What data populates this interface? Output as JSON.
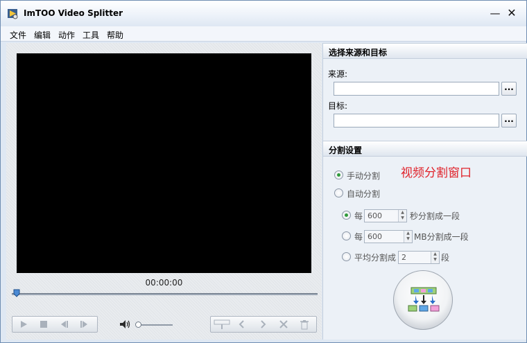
{
  "window": {
    "title": "ImTOO Video Splitter",
    "minimize": "—",
    "close": "✕"
  },
  "menu": [
    "文件",
    "编辑",
    "动作",
    "工具",
    "帮助"
  ],
  "player": {
    "time": "00:00:00",
    "seek_fraction": 0.0
  },
  "source_target": {
    "header": "选择来源和目标",
    "source_label": "来源:",
    "source_value": "",
    "target_label": "目标:",
    "target_value": "",
    "browse": "..."
  },
  "split_settings": {
    "header": "分割设置",
    "manual": "手动分割",
    "auto": "自动分割",
    "every_sec": {
      "prefix": "每",
      "value": "600",
      "suffix": "秒分割成一段"
    },
    "every_mb": {
      "prefix": "每",
      "value": "600",
      "suffix": "MB分割成一段"
    },
    "average": {
      "prefix": "平均分割成",
      "value": "2",
      "suffix": "段"
    }
  },
  "overlay_caption": "视频分割窗口"
}
